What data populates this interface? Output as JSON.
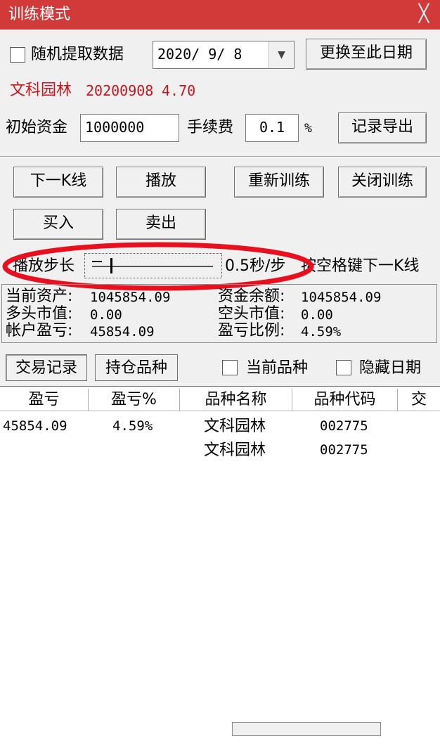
{
  "window": {
    "title": "训练模式",
    "close_glyph": "╳"
  },
  "random": {
    "label": "随机提取数据",
    "checked": false
  },
  "date": {
    "value": "2020/  9/  8",
    "button": "更换至此日期"
  },
  "stock": {
    "name": "文科园林",
    "date": "20200908",
    "price": "4.70"
  },
  "capital": {
    "label": "初始资金",
    "value": "1000000",
    "fee_label": "手续费",
    "fee_value": "0.1",
    "fee_unit": "%",
    "export_button": "记录导出"
  },
  "controls": {
    "next_k": "下一K线",
    "play": "播放",
    "restart": "重新训练",
    "close_training": "关闭训练",
    "buy": "买入",
    "sell": "卖出"
  },
  "speed": {
    "label": "播放步长",
    "value_text": "0.5秒/步",
    "hint": "按空格键下一K线",
    "level": 0.15
  },
  "account": {
    "assets_label": "当前资产:",
    "assets": "1045854.09",
    "cash_label": "资金余额:",
    "cash": "1045854.09",
    "long_label": "多头市值:",
    "long": "0.00",
    "short_label": "空头市值:",
    "short": "0.00",
    "pnl_label": "帐户盈亏:",
    "pnl": "45854.09",
    "pnl_pct_label": "盈亏比例:",
    "pnl_pct": "4.59%"
  },
  "tabs": {
    "records": "交易记录",
    "positions": "持仓品种",
    "current_label": "当前品种",
    "hide_date_label": "隐藏日期"
  },
  "table": {
    "columns": [
      "盈亏",
      "盈亏%",
      "品种名称",
      "品种代码",
      "交"
    ],
    "rows": [
      [
        "45854.09",
        "4.59%",
        "文科园林",
        "002775"
      ],
      [
        "",
        "",
        "文科园林",
        "002775"
      ]
    ]
  },
  "colors": {
    "accent": "#d23a3a",
    "highlight": "#e8101e"
  }
}
